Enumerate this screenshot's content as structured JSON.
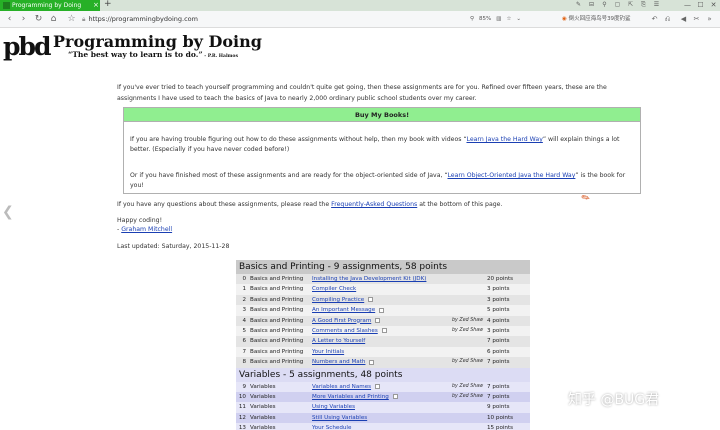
{
  "browser": {
    "tab_title": "Programming by Doing",
    "tab_close": "×",
    "new_tab": "+",
    "url": "https://programmingbydoing.com",
    "zoom": "85%",
    "hot_search": "倒火回应海鸟号39度钓鲨",
    "window_controls": [
      "—",
      "☐",
      "✕"
    ],
    "toolbar_icons": [
      "✎",
      "⊟",
      "⚲",
      "▢",
      "⇱",
      "⎘",
      "☰"
    ]
  },
  "site": {
    "logo_text": "pbd",
    "title": "Programming by Doing",
    "quote": "“The best way to learn is to do.”",
    "quote_attr": " - P.R. Halmos"
  },
  "intro": "If you've ever tried to teach yourself programming and couldn't quite get going, then these assignments are for you. Refined over fifteen years, these are the assignments I have used to teach the basics of Java to nearly 2,000 ordinary public school students over my career.",
  "books": {
    "heading": "Buy My Books!",
    "p1_before": "If you are having trouble figuring out how to do these assignments without help, then my book with videos “",
    "p1_link": "Learn Java the Hard Way",
    "p1_after": "” will explain things a lot better. (Especially if you have never coded before!)",
    "p2_before": "Or if you have finished most of these assignments and are ready for the object-oriented side of Java, “",
    "p2_link": "Learn Object-Oriented Java the Hard Way",
    "p2_after": "” is the book for you!"
  },
  "faq": {
    "before": "If you have any questions about these assignments, please read the ",
    "link": "Frequently-Asked Questions",
    "after": " at the bottom of this page."
  },
  "signoff": {
    "line1": "Happy coding!",
    "line2_prefix": "- ",
    "line2_link": "Graham Mitchell"
  },
  "last_updated": "Last updated: Saturday, 2015-11-28",
  "sections": [
    {
      "heading": "Basics and Printing - 9 assignments, 58 points",
      "rows": [
        {
          "n": "0",
          "cat": "Basics and Printing",
          "title": "Installing the Java Development Kit (JDK)",
          "nb": false,
          "by": "",
          "pts": "20 points"
        },
        {
          "n": "1",
          "cat": "Basics and Printing",
          "title": "Compiler Check",
          "nb": false,
          "by": "",
          "pts": "3 points"
        },
        {
          "n": "2",
          "cat": "Basics and Printing",
          "title": "Compiling Practice",
          "nb": true,
          "by": "",
          "pts": "3 points"
        },
        {
          "n": "3",
          "cat": "Basics and Printing",
          "title": "An Important Message",
          "nb": true,
          "by": "",
          "pts": "5 points"
        },
        {
          "n": "4",
          "cat": "Basics and Printing",
          "title": "A Good First Program",
          "nb": true,
          "by": "by Zed Shaw",
          "pts": "4 points"
        },
        {
          "n": "5",
          "cat": "Basics and Printing",
          "title": "Comments and Slashes",
          "nb": true,
          "by": "by Zed Shaw",
          "pts": "3 points"
        },
        {
          "n": "6",
          "cat": "Basics and Printing",
          "title": "A Letter to Yourself",
          "nb": false,
          "by": "",
          "pts": "7 points"
        },
        {
          "n": "7",
          "cat": "Basics and Printing",
          "title": "Your Initials",
          "nb": false,
          "by": "",
          "pts": "6 points"
        },
        {
          "n": "8",
          "cat": "Basics and Printing",
          "title": "Numbers and Math",
          "nb": true,
          "by": "by Zed Shaw",
          "pts": "7 points"
        }
      ]
    },
    {
      "heading": "Variables - 5 assignments, 48 points",
      "rows": [
        {
          "n": "9",
          "cat": "Variables",
          "title": "Variables and Names",
          "nb": true,
          "by": "by Zed Shaw",
          "pts": "7 points"
        },
        {
          "n": "10",
          "cat": "Variables",
          "title": "More Variables and Printing",
          "nb": true,
          "by": "by Zed Shaw",
          "pts": "7 points"
        },
        {
          "n": "11",
          "cat": "Variables",
          "title": "Using Variables",
          "nb": false,
          "by": "",
          "pts": "9 points"
        },
        {
          "n": "12",
          "cat": "Variables",
          "title": "Still Using Variables",
          "nb": false,
          "by": "",
          "pts": "10 points"
        },
        {
          "n": "13",
          "cat": "Variables",
          "title": "Your Schedule",
          "nb": false,
          "by": "",
          "pts": "15 points"
        }
      ]
    }
  ],
  "watermark": "知乎 @BUG君"
}
